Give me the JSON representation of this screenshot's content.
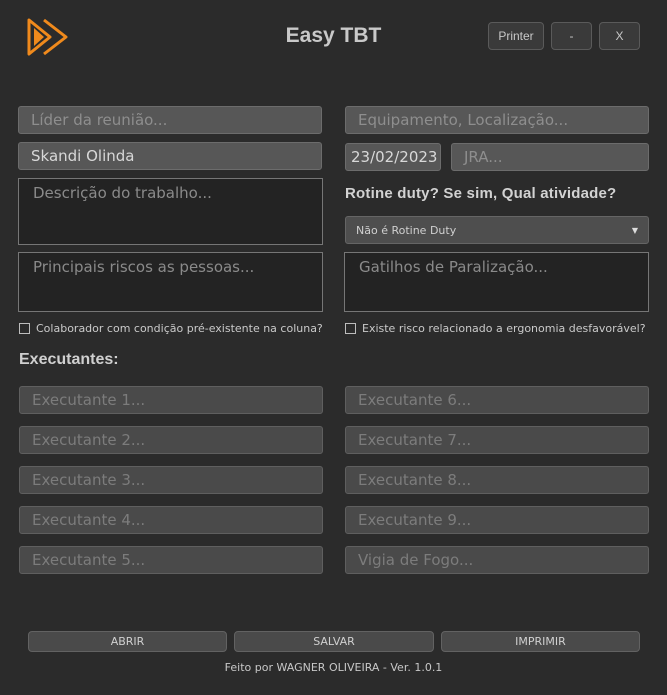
{
  "app": {
    "title": "Easy TBT",
    "logo_icon": "double-play-arrow-icon",
    "accent_color": "#f08a1c"
  },
  "window_buttons": {
    "printer": "Printer",
    "minimize": "-",
    "close": "X"
  },
  "form": {
    "leader_placeholder": "Líder da reunião...",
    "equipment_placeholder": "Equipamento, Localização...",
    "vessel_value": "Skandi Olinda",
    "date_value": "23/02/2023",
    "jra_placeholder": "JRA...",
    "work_description_placeholder": "Descrição do trabalho...",
    "main_risks_placeholder": "Principais riscos as pessoas...",
    "stop_triggers_placeholder": "Gatilhos de Paralização...",
    "routine_question": "Rotine duty? Se sim, Qual atividade?",
    "routine_selected": "Não é Rotine Duty",
    "checkbox_spine": "Colaborador com condição pré-existente na coluna?",
    "checkbox_ergonomics": "Existe risco relacionado a ergonomia desfavorável?"
  },
  "executantes": {
    "heading": "Executantes:",
    "left": [
      "Executante 1...",
      "Executante 2...",
      "Executante 3...",
      "Executante 4...",
      "Executante 5..."
    ],
    "right": [
      "Executante 6...",
      "Executante 7...",
      "Executante 8...",
      "Executante 9...",
      "Vigia de Fogo..."
    ]
  },
  "actions": {
    "open": "ABRIR",
    "save": "SALVAR",
    "print": "IMPRIMIR"
  },
  "footer": "Feito por WAGNER OLIVEIRA - Ver. 1.0.1"
}
